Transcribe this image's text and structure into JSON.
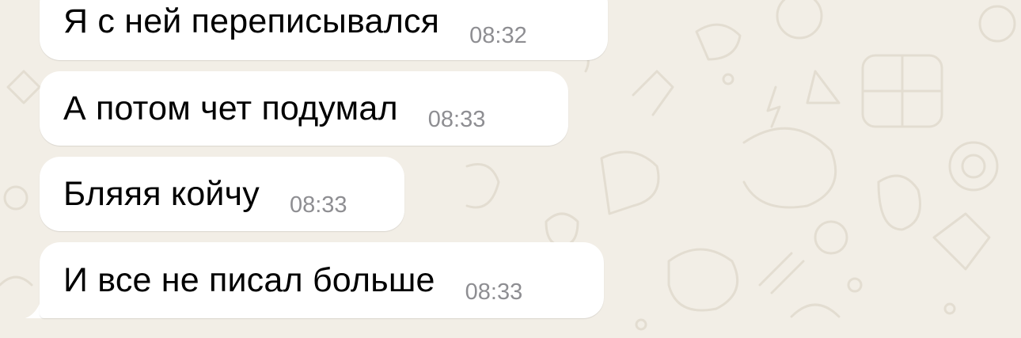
{
  "chat": {
    "messages": [
      {
        "text": "Я с ней переписывался",
        "time": "08:32"
      },
      {
        "text": "А потом чет подумал",
        "time": "08:33"
      },
      {
        "text": "Бляяя койчу",
        "time": "08:33"
      },
      {
        "text": "И все не писал больше",
        "time": "08:33"
      }
    ]
  },
  "colors": {
    "background": "#f2eee6",
    "bubble": "#ffffff",
    "text": "#000000",
    "timestamp": "#8e8e92",
    "doodle": "#e3ddd1"
  }
}
